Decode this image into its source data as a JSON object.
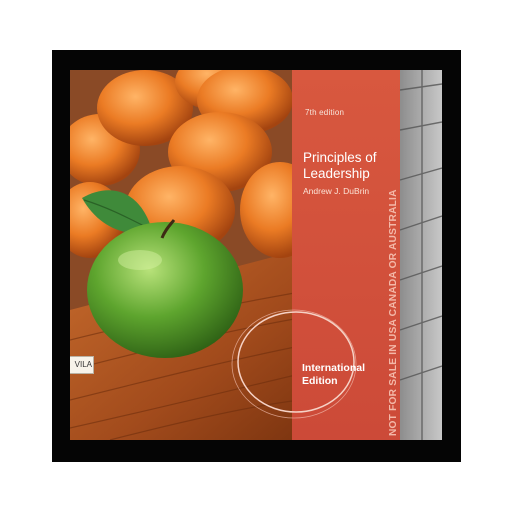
{
  "book": {
    "edition": "7th edition",
    "title_line1": "Principles of",
    "title_line2": "Leadership",
    "author": "Andrew J. DuBrin",
    "badge_line1": "International",
    "badge_line2": "Edition",
    "rights_notice": "NOT FOR SALE IN USA CANADA OR AUSTRALIA",
    "library_label": "VILA"
  },
  "colors": {
    "red_panel": "#d2503e",
    "frame": "#050505",
    "orange": "#e8731f",
    "apple": "#5aa02c"
  }
}
